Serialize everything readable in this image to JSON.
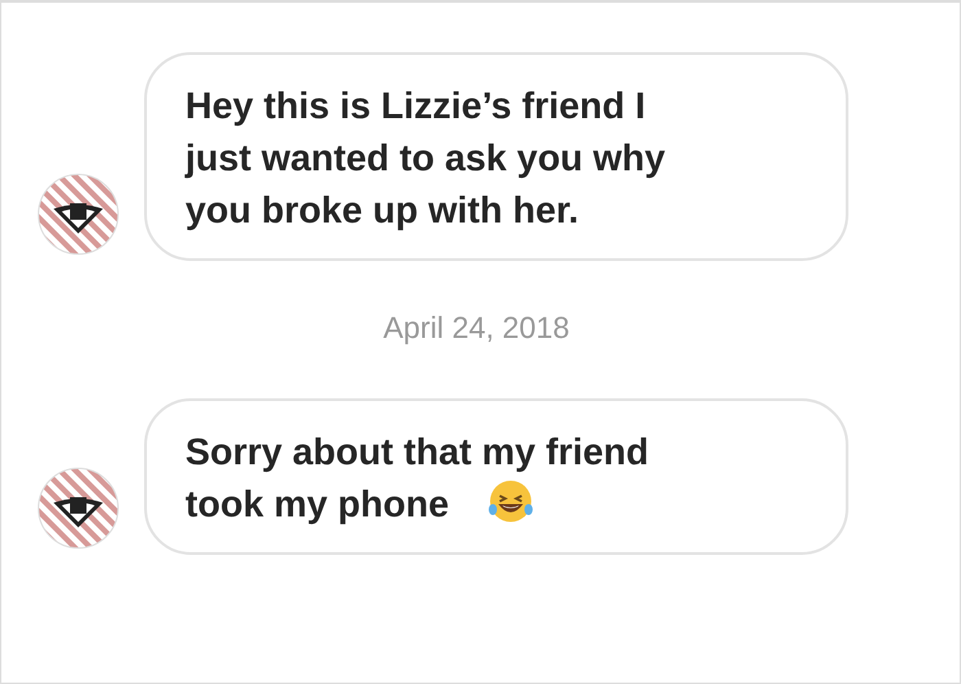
{
  "messages": [
    {
      "kind": "message",
      "text": "Hey this is Lizzie’s friend I just wanted to ask you why you broke up with her.",
      "emoji": false
    },
    {
      "kind": "date",
      "text": "April 24, 2018"
    },
    {
      "kind": "message",
      "text": "Sorry about that my friend took my phone",
      "emoji": true
    }
  ]
}
